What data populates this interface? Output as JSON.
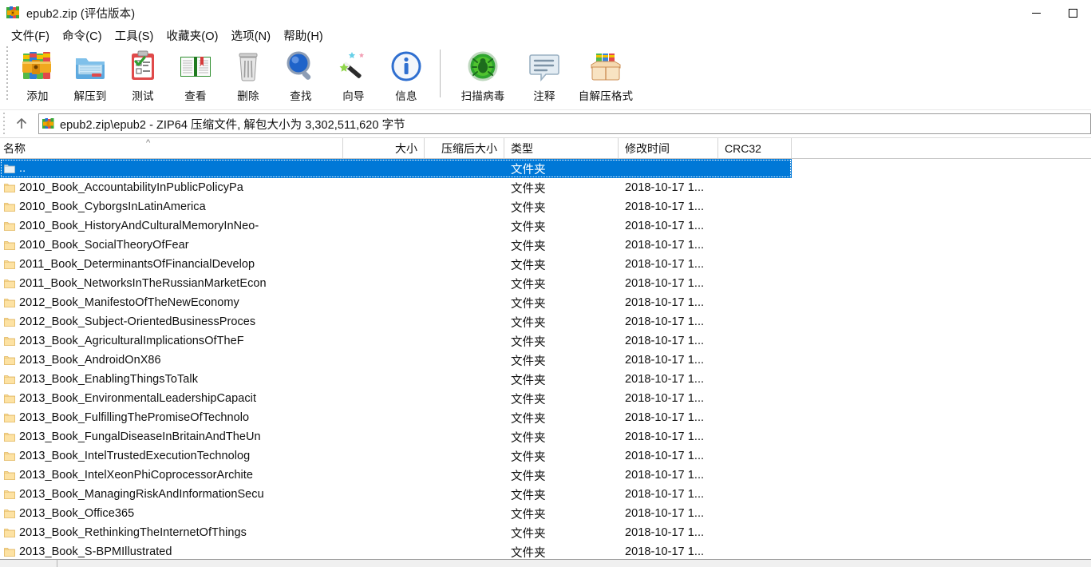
{
  "window": {
    "title": "epub2.zip (评估版本)",
    "icon": "winrar-books-icon",
    "controls": {
      "minimize": "minimize-icon",
      "maximize": "maximize-icon"
    }
  },
  "menubar": {
    "items": [
      {
        "label": "文件(F)",
        "name": "menu-file"
      },
      {
        "label": "命令(C)",
        "name": "menu-commands"
      },
      {
        "label": "工具(S)",
        "name": "menu-tools"
      },
      {
        "label": "收藏夹(O)",
        "name": "menu-favorites"
      },
      {
        "label": "选项(N)",
        "name": "menu-options"
      },
      {
        "label": "帮助(H)",
        "name": "menu-help"
      }
    ]
  },
  "toolbar": {
    "buttons": [
      {
        "label": "添加",
        "icon": "add-archive-icon"
      },
      {
        "label": "解压到",
        "icon": "extract-to-folder-icon"
      },
      {
        "label": "测试",
        "icon": "test-clipboard-icon"
      },
      {
        "label": "查看",
        "icon": "view-book-icon"
      },
      {
        "label": "删除",
        "icon": "delete-trash-icon"
      },
      {
        "label": "查找",
        "icon": "find-magnifier-icon"
      },
      {
        "label": "向导",
        "icon": "wizard-wand-icon"
      },
      {
        "label": "信息",
        "icon": "info-circle-icon"
      },
      {
        "label": "扫描病毒",
        "icon": "virus-scan-bug-icon"
      },
      {
        "label": "注释",
        "icon": "comment-bubble-icon"
      },
      {
        "label": "自解压格式",
        "icon": "sfx-box-icon"
      }
    ],
    "separator_after_index": 7
  },
  "addressbar": {
    "up_button": "up-arrow-icon",
    "archive_icon": "winrar-books-icon",
    "path_text": "epub2.zip\\epub2 - ZIP64 压缩文件, 解包大小为 3,302,511,620 字节"
  },
  "columns": {
    "name": "名称",
    "size": "大小",
    "packed": "压缩后大小",
    "type": "类型",
    "modified": "修改时间",
    "crc32": "CRC32",
    "sort_indicator": "^",
    "sort_column": "名称",
    "sort_direction": "ascending"
  },
  "files": [
    {
      "name": "..",
      "size": "",
      "packed": "",
      "type": "文件夹",
      "modified": "",
      "crc32": "",
      "selected": true,
      "icon": "parent-folder-icon"
    },
    {
      "name": "2010_Book_AccountabilityInPublicPolicyPa",
      "size": "",
      "packed": "",
      "type": "文件夹",
      "modified": "2018-10-17 1...",
      "crc32": "",
      "selected": false,
      "icon": "folder-icon"
    },
    {
      "name": "2010_Book_CyborgsInLatinAmerica",
      "size": "",
      "packed": "",
      "type": "文件夹",
      "modified": "2018-10-17 1...",
      "crc32": "",
      "selected": false,
      "icon": "folder-icon"
    },
    {
      "name": "2010_Book_HistoryAndCulturalMemoryInNeo-",
      "size": "",
      "packed": "",
      "type": "文件夹",
      "modified": "2018-10-17 1...",
      "crc32": "",
      "selected": false,
      "icon": "folder-icon"
    },
    {
      "name": "2010_Book_SocialTheoryOfFear",
      "size": "",
      "packed": "",
      "type": "文件夹",
      "modified": "2018-10-17 1...",
      "crc32": "",
      "selected": false,
      "icon": "folder-icon"
    },
    {
      "name": "2011_Book_DeterminantsOfFinancialDevelop",
      "size": "",
      "packed": "",
      "type": "文件夹",
      "modified": "2018-10-17 1...",
      "crc32": "",
      "selected": false,
      "icon": "folder-icon"
    },
    {
      "name": "2011_Book_NetworksInTheRussianMarketEcon",
      "size": "",
      "packed": "",
      "type": "文件夹",
      "modified": "2018-10-17 1...",
      "crc32": "",
      "selected": false,
      "icon": "folder-icon"
    },
    {
      "name": "2012_Book_ManifestoOfTheNewEconomy",
      "size": "",
      "packed": "",
      "type": "文件夹",
      "modified": "2018-10-17 1...",
      "crc32": "",
      "selected": false,
      "icon": "folder-icon"
    },
    {
      "name": "2012_Book_Subject-OrientedBusinessProces",
      "size": "",
      "packed": "",
      "type": "文件夹",
      "modified": "2018-10-17 1...",
      "crc32": "",
      "selected": false,
      "icon": "folder-icon"
    },
    {
      "name": "2013_Book_AgriculturalImplicationsOfTheF",
      "size": "",
      "packed": "",
      "type": "文件夹",
      "modified": "2018-10-17 1...",
      "crc32": "",
      "selected": false,
      "icon": "folder-icon"
    },
    {
      "name": "2013_Book_AndroidOnX86",
      "size": "",
      "packed": "",
      "type": "文件夹",
      "modified": "2018-10-17 1...",
      "crc32": "",
      "selected": false,
      "icon": "folder-icon"
    },
    {
      "name": "2013_Book_EnablingThingsToTalk",
      "size": "",
      "packed": "",
      "type": "文件夹",
      "modified": "2018-10-17 1...",
      "crc32": "",
      "selected": false,
      "icon": "folder-icon"
    },
    {
      "name": "2013_Book_EnvironmentalLeadershipCapacit",
      "size": "",
      "packed": "",
      "type": "文件夹",
      "modified": "2018-10-17 1...",
      "crc32": "",
      "selected": false,
      "icon": "folder-icon"
    },
    {
      "name": "2013_Book_FulfillingThePromiseOfTechnolo",
      "size": "",
      "packed": "",
      "type": "文件夹",
      "modified": "2018-10-17 1...",
      "crc32": "",
      "selected": false,
      "icon": "folder-icon"
    },
    {
      "name": "2013_Book_FungalDiseaseInBritainAndTheUn",
      "size": "",
      "packed": "",
      "type": "文件夹",
      "modified": "2018-10-17 1...",
      "crc32": "",
      "selected": false,
      "icon": "folder-icon"
    },
    {
      "name": "2013_Book_IntelTrustedExecutionTechnolog",
      "size": "",
      "packed": "",
      "type": "文件夹",
      "modified": "2018-10-17 1...",
      "crc32": "",
      "selected": false,
      "icon": "folder-icon"
    },
    {
      "name": "2013_Book_IntelXeonPhiCoprocessorArchite",
      "size": "",
      "packed": "",
      "type": "文件夹",
      "modified": "2018-10-17 1...",
      "crc32": "",
      "selected": false,
      "icon": "folder-icon"
    },
    {
      "name": "2013_Book_ManagingRiskAndInformationSecu",
      "size": "",
      "packed": "",
      "type": "文件夹",
      "modified": "2018-10-17 1...",
      "crc32": "",
      "selected": false,
      "icon": "folder-icon"
    },
    {
      "name": "2013_Book_Office365",
      "size": "",
      "packed": "",
      "type": "文件夹",
      "modified": "2018-10-17 1...",
      "crc32": "",
      "selected": false,
      "icon": "folder-icon"
    },
    {
      "name": "2013_Book_RethinkingTheInternetOfThings",
      "size": "",
      "packed": "",
      "type": "文件夹",
      "modified": "2018-10-17 1...",
      "crc32": "",
      "selected": false,
      "icon": "folder-icon"
    },
    {
      "name": "2013_Book_S-BPMIllustrated",
      "size": "",
      "packed": "",
      "type": "文件夹",
      "modified": "2018-10-17 1...",
      "crc32": "",
      "selected": false,
      "icon": "folder-icon"
    }
  ],
  "colors": {
    "selection": "#0078d7",
    "folder": "#fde29b",
    "window_bg": "#ffffff",
    "text": "#101010"
  }
}
